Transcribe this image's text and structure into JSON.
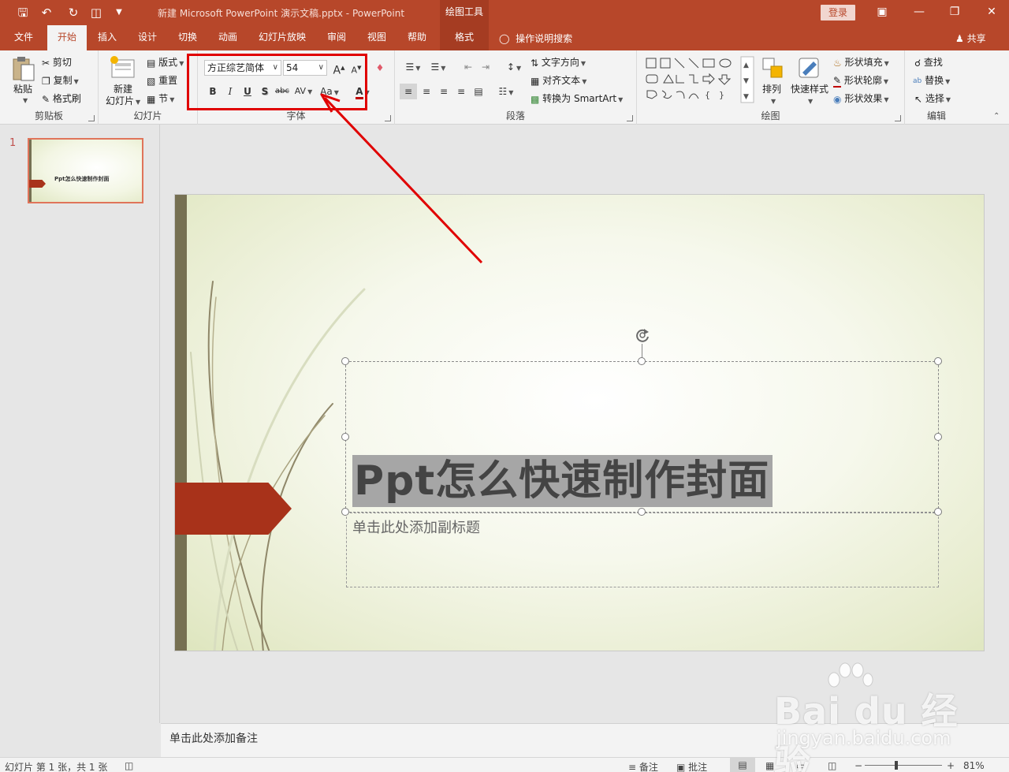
{
  "app": {
    "doc_title": "新建 Microsoft PowerPoint 演示文稿.pptx  -  PowerPoint",
    "context_tools": "绘图工具",
    "login": "登录",
    "share": "共享",
    "tell_me": "操作说明搜索"
  },
  "tabs": [
    {
      "label": "文件"
    },
    {
      "label": "开始"
    },
    {
      "label": "插入"
    },
    {
      "label": "设计"
    },
    {
      "label": "切换"
    },
    {
      "label": "动画"
    },
    {
      "label": "幻灯片放映"
    },
    {
      "label": "审阅"
    },
    {
      "label": "视图"
    },
    {
      "label": "帮助"
    },
    {
      "label": "格式"
    }
  ],
  "ribbon": {
    "clipboard": {
      "label": "剪贴板",
      "paste": "粘贴",
      "cut": "剪切",
      "copy": "复制",
      "format_painter": "格式刷"
    },
    "slides": {
      "label": "幻灯片",
      "new_slide_1": "新建",
      "new_slide_2": "幻灯片",
      "layout": "版式",
      "reset": "重置",
      "section": "节"
    },
    "font": {
      "label": "字体",
      "font_name": "方正综艺简体",
      "font_size": "54",
      "bold": "B",
      "italic": "I",
      "underline": "U",
      "shadow": "S",
      "strike": "abc",
      "spacing": "AV",
      "case": "Aa",
      "color": "A",
      "grow": "A",
      "shrink": "A"
    },
    "paragraph": {
      "label": "段落",
      "text_direction": "文字方向",
      "align_text": "对齐文本",
      "smartart": "转换为 SmartArt"
    },
    "drawing": {
      "label": "绘图",
      "arrange": "排列",
      "quick_styles": "快速样式",
      "fill": "形状填充",
      "outline": "形状轮廓",
      "effects": "形状效果"
    },
    "editing": {
      "label": "编辑",
      "find": "查找",
      "replace": "替换",
      "select": "选择"
    }
  },
  "thumbs": {
    "number": "1",
    "title": "Ppt怎么快速制作封面"
  },
  "slide": {
    "title": "Ppt怎么快速制作封面",
    "subtitle": "单击此处添加副标题"
  },
  "notes": {
    "placeholder": "单击此处添加备注"
  },
  "status": {
    "slide_info": "幻灯片 第 1 张，共 1 张",
    "notes_btn": "备注",
    "comments_btn": "批注",
    "zoom": "81%",
    "minus": "−",
    "plus": "+"
  },
  "watermark": {
    "main": "Bai du 经验",
    "sub": "jingyan.baidu.com"
  },
  "colors": {
    "accent": "#b7472a",
    "annotation": "#e00000",
    "slide_bar": "#767052",
    "slide_tag": "#a8321a"
  }
}
